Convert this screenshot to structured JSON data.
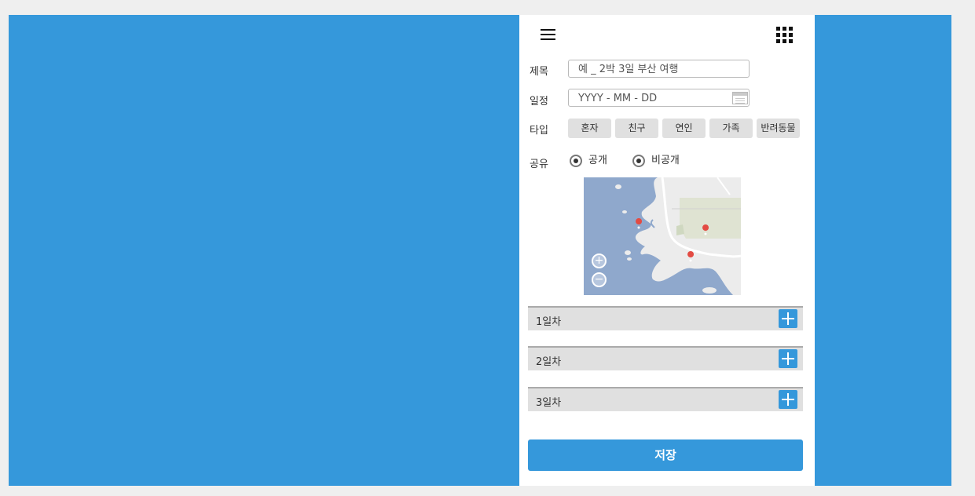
{
  "header": {
    "menu_icon": "hamburger-icon",
    "apps_icon": "grid-icon"
  },
  "form": {
    "title_label": "제목",
    "title_placeholder": "예 _ 2박 3일 부산 여행",
    "schedule_label": "일정",
    "schedule_placeholder": "YYYY - MM - DD",
    "type_label": "타입",
    "types": [
      "혼자",
      "친구",
      "연인",
      "가족",
      "반려동물"
    ],
    "share_label": "공유",
    "share_options": [
      "공개",
      "비공개"
    ]
  },
  "days": [
    "1일차",
    "2일차",
    "3일차"
  ],
  "save_label": "저장",
  "colors": {
    "accent": "#3598db",
    "button_gray": "#e0e0e0",
    "map_water": "#8fa8cc",
    "pin": "#e34b43"
  }
}
